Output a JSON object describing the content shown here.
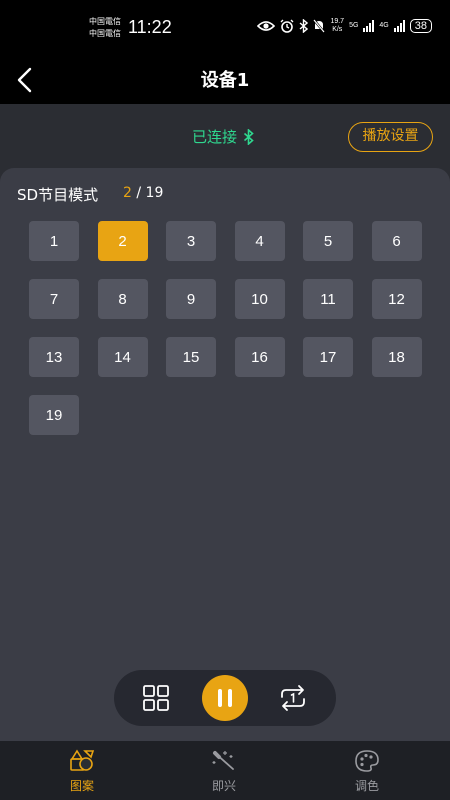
{
  "status_bar": {
    "carrier_1": "中国電信",
    "carrier_2": "中国電信",
    "time": "11:22",
    "speed_value": "19.7",
    "speed_unit": "K/s",
    "net_5g": "5G",
    "net_4g": "4G",
    "battery": "38"
  },
  "header": {
    "title": "设备1"
  },
  "connection": {
    "status": "已连接",
    "play_settings_label": "播放设置"
  },
  "panel": {
    "mode_title": "SD节目模式",
    "current": "2",
    "separator": "/",
    "total": "19",
    "programs": [
      "1",
      "2",
      "3",
      "4",
      "5",
      "6",
      "7",
      "8",
      "9",
      "10",
      "11",
      "12",
      "13",
      "14",
      "15",
      "16",
      "17",
      "18",
      "19"
    ],
    "selected_index": 1
  },
  "bottom_nav": {
    "items": [
      {
        "label": "图案",
        "icon": "shapes-icon",
        "active": true
      },
      {
        "label": "即兴",
        "icon": "magic-wand-icon",
        "active": false
      },
      {
        "label": "调色",
        "icon": "palette-icon",
        "active": false
      }
    ]
  },
  "colors": {
    "accent": "#e8a413",
    "connected": "#2fd78f",
    "panel": "#3b3d46",
    "button": "#545661"
  }
}
